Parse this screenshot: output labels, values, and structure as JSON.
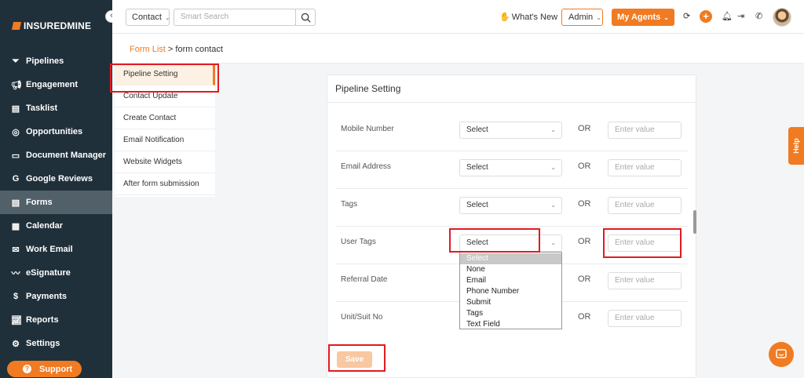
{
  "brand": {
    "logo_text": "INSUREDMINE"
  },
  "sidebar": {
    "items": [
      {
        "label": "Pipelines",
        "icon": "filter-icon"
      },
      {
        "label": "Engagement",
        "icon": "megaphone-icon"
      },
      {
        "label": "Tasklist",
        "icon": "clipboard-icon"
      },
      {
        "label": "Opportunities",
        "icon": "bullseye-icon"
      },
      {
        "label": "Document Manager",
        "icon": "folder-icon"
      },
      {
        "label": "Google Reviews",
        "icon": "google-icon"
      },
      {
        "label": "Forms",
        "icon": "form-icon"
      },
      {
        "label": "Calendar",
        "icon": "calendar-icon"
      },
      {
        "label": "Work Email",
        "icon": "mail-icon"
      },
      {
        "label": "eSignature",
        "icon": "signature-icon"
      },
      {
        "label": "Payments",
        "icon": "dollar-icon"
      },
      {
        "label": "Reports",
        "icon": "chart-icon"
      },
      {
        "label": "Settings",
        "icon": "gear-icon"
      }
    ],
    "active": "Forms",
    "support_label": "Support"
  },
  "topbar": {
    "search_scope": "Contact",
    "search_placeholder": "Smart Search",
    "whats_new": "What's New",
    "role": "Admin",
    "agents_label": "My Agents"
  },
  "breadcrumb": {
    "parent": "Form List",
    "separator": ">",
    "current": "form contact"
  },
  "tabs": [
    "Pipeline Setting",
    "Contact Update",
    "Create Contact",
    "Email Notification",
    "Website Widgets",
    "After form submission"
  ],
  "card": {
    "title": "Pipeline Setting",
    "or_label": "OR",
    "value_placeholder": "Enter value",
    "select_default": "Select",
    "rows": [
      {
        "label": "Mobile Number",
        "select": "Select"
      },
      {
        "label": "Email Address",
        "select": "Select"
      },
      {
        "label": "Tags",
        "select": "Select"
      },
      {
        "label": "User Tags",
        "select": "Select"
      },
      {
        "label": "Referral Date",
        "select": "Select"
      },
      {
        "label": "Unit/Suit No",
        "select": "Select"
      }
    ],
    "dropdown_options": [
      "Select",
      "None",
      "Email",
      "Phone Number",
      "Submit",
      "Tags",
      "Text Field"
    ],
    "save_label": "Save"
  },
  "help_label": "Help"
}
